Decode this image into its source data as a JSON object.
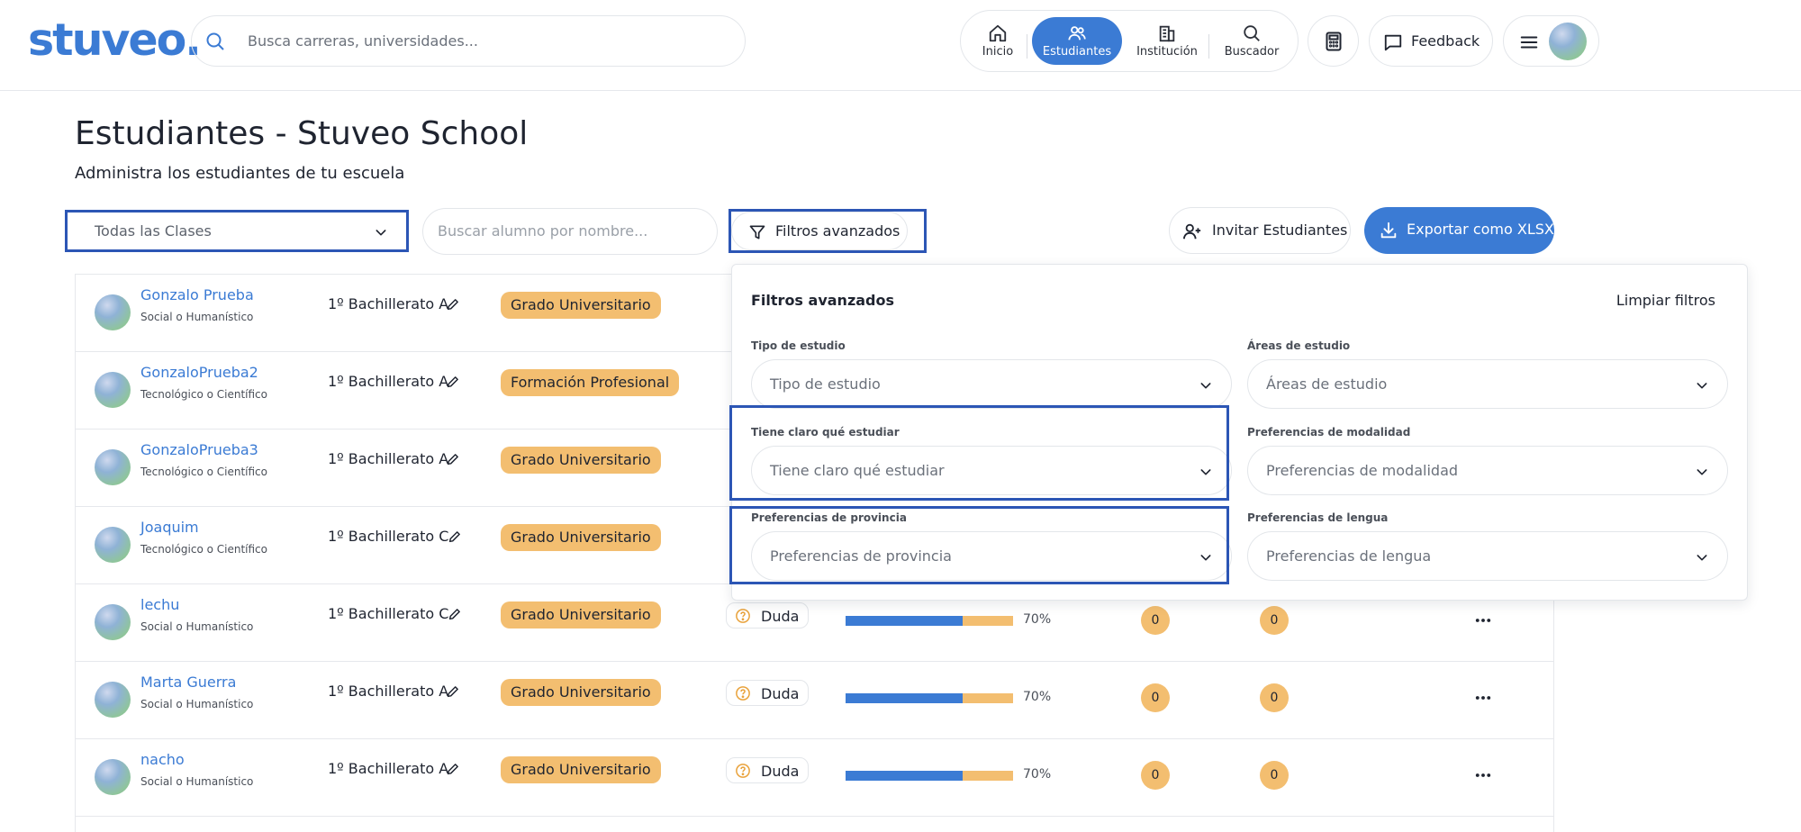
{
  "header": {
    "logo": "stuveo.",
    "search_placeholder": "Busca carreras, universidades...",
    "nav": [
      {
        "label": "Inicio",
        "icon": "home-icon",
        "active": false
      },
      {
        "label": "Estudiantes",
        "icon": "users-icon",
        "active": true
      },
      {
        "label": "Institución",
        "icon": "building-icon",
        "active": false
      },
      {
        "label": "Buscador",
        "icon": "search-icon",
        "active": false
      }
    ],
    "feedback_label": "Feedback"
  },
  "page": {
    "title": "Estudiantes - Stuveo School",
    "subtitle": "Administra los estudiantes de tu escuela"
  },
  "toolbar": {
    "class_select": "Todas las Clases",
    "student_search_placeholder": "Buscar alumno por nombre...",
    "advanced_filters_label": "Filtros avanzados",
    "invite_label": "Invitar Estudiantes",
    "export_label": "Exportar como XLSX"
  },
  "students": [
    {
      "name": "Gonzalo Prueba",
      "branch": "Social o Humanístico",
      "class": "1º Bachillerato A",
      "study_type": "Grado Universitario"
    },
    {
      "name": "GonzaloPrueba2",
      "branch": "Tecnológico o Científico",
      "class": "1º Bachillerato A",
      "study_type": "Formación Profesional"
    },
    {
      "name": "GonzaloPrueba3",
      "branch": "Tecnológico o Científico",
      "class": "1º Bachillerato A",
      "study_type": "Grado Universitario"
    },
    {
      "name": "Joaquim",
      "branch": "Tecnológico o Científico",
      "class": "1º Bachillerato C",
      "study_type": "Grado Universitario"
    },
    {
      "name": "lechu",
      "branch": "Social o Humanístico",
      "class": "1º Bachillerato C",
      "study_type": "Grado Universitario",
      "status": "Duda",
      "progress_label": "70%",
      "progress": 0.7,
      "count_a": "0",
      "count_b": "0"
    },
    {
      "name": "Marta Guerra",
      "branch": "Social o Humanístico",
      "class": "1º Bachillerato A",
      "study_type": "Grado Universitario",
      "status": "Duda",
      "progress_label": "70%",
      "progress": 0.7,
      "count_a": "0",
      "count_b": "0"
    },
    {
      "name": "nacho",
      "branch": "Social o Humanístico",
      "class": "1º Bachillerato A",
      "study_type": "Grado Universitario",
      "status": "Duda",
      "progress_label": "70%",
      "progress": 0.7,
      "count_a": "0",
      "count_b": "0"
    }
  ],
  "filters_panel": {
    "title": "Filtros avanzados",
    "clear_label": "Limpiar filtros",
    "fields": [
      {
        "label": "Tipo de estudio",
        "placeholder": "Tipo de estudio"
      },
      {
        "label": "Áreas de estudio",
        "placeholder": "Áreas de estudio"
      },
      {
        "label": "Tiene claro qué estudiar",
        "placeholder": "Tiene claro qué estudiar"
      },
      {
        "label": "Preferencias de modalidad",
        "placeholder": "Preferencias de modalidad"
      },
      {
        "label": "Preferencias de provincia",
        "placeholder": "Preferencias de provincia"
      },
      {
        "label": "Preferencias de lengua",
        "placeholder": "Preferencias de lengua"
      }
    ]
  },
  "colors": {
    "accent": "#3b7bd4",
    "badge": "#f3be70",
    "highlight": "#2c56b5"
  }
}
